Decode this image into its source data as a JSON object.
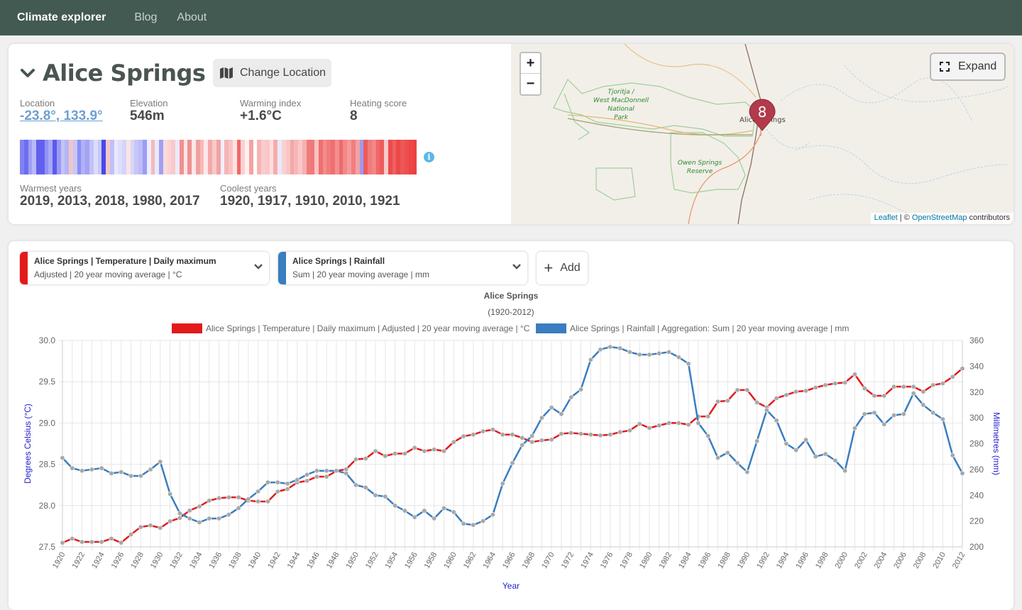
{
  "nav": {
    "brand": "Climate explorer",
    "links": [
      "Blog",
      "About"
    ]
  },
  "location": {
    "title": "Alice Springs",
    "change_label": "Change Location",
    "stats": [
      {
        "label": "Location",
        "value": "-23.8°, 133.9°",
        "link": true
      },
      {
        "label": "Elevation",
        "value": "546m"
      },
      {
        "label": "Warming index",
        "value": "+1.6°C"
      },
      {
        "label": "Heating score",
        "value": "8"
      }
    ],
    "warmest_label": "Warmest years",
    "warmest_value": "2019, 2013, 2018, 1980, 2017",
    "coolest_label": "Coolest years",
    "coolest_value": "1920, 1917, 1910, 2010, 1921",
    "stripe_colors": [
      "#8282f2",
      "#6d6df0",
      "#9f9ff5",
      "#b9b9f7",
      "#6060ee",
      "#6060ee",
      "#9292f4",
      "#a9a9f5",
      "#5a5aee",
      "#9a9af4",
      "#c3c3f8",
      "#b5b5f6",
      "#f0c5c5",
      "#c6c6f8",
      "#8e8ef3",
      "#b0b0f6",
      "#a3a3f4",
      "#c2c2f7",
      "#dcdcfa",
      "#c9c9f8",
      "#4848ec",
      "#f5c7c7",
      "#c0c0f7",
      "#e8e8fc",
      "#dedefb",
      "#d4d4fa",
      "#f9e4e4",
      "#d6d6fa",
      "#c6c6f8",
      "#bdbdf7",
      "#9c9cf4",
      "#ededfd",
      "#f4b9b9",
      "#e9e9fc",
      "#a0a0f5",
      "#fadada",
      "#f9d3d3",
      "#f7caca",
      "#eaeafc",
      "#f48f8f",
      "#fbe5e5",
      "#f09090",
      "#fbe7e7",
      "#f29f9f",
      "#f6b9b9",
      "#fde9e9",
      "#f4a9a9",
      "#f8c9c9",
      "#f1a3a3",
      "#ecf0ff",
      "#f5b5b5",
      "#f8c3c3",
      "#fde3e3",
      "#ef6969",
      "#f9d0d0",
      "#fff0f0",
      "#f5a1a1",
      "#ffffff",
      "#f7b3b3",
      "#f8cccc",
      "#f9c7c7",
      "#fcdede",
      "#f4adad",
      "#e9e9fc",
      "#fad1d1",
      "#f8c5c5",
      "#f4a7a7",
      "#f7b7b7",
      "#f9c8c8",
      "#f6b1b1",
      "#f07c7c",
      "#f07979",
      "#f8c3c3",
      "#f06f6f",
      "#f28c8c",
      "#f07b7b",
      "#ef7070",
      "#f09090",
      "#ee6a6a",
      "#f28888",
      "#f39b9b",
      "#f07e7e",
      "#f4a2a2",
      "#9b9bf4",
      "#ed5a5a",
      "#f07b7b",
      "#f38686",
      "#f06767",
      "#ee5b5b",
      "#f9cbcb",
      "#ec4b4b",
      "#f05f5f",
      "#ec4848",
      "#ee5757",
      "#ed4f4f",
      "#ec4646",
      "#ec4141"
    ],
    "info_icon": "info-icon"
  },
  "map": {
    "zoom_in": "+",
    "zoom_out": "−",
    "expand_label": "Expand",
    "marker_label": "8",
    "place_label": "Alice Springs",
    "park1": [
      "Tjoritja /",
      "West MacDonnell",
      "National",
      "Park"
    ],
    "park2": [
      "Owen Springs",
      "Reserve"
    ],
    "attr_leaflet": "Leaflet",
    "attr_sep": " | © ",
    "attr_osm": "OpenStreetMap",
    "attr_tail": " contributors"
  },
  "series_selectors": [
    {
      "line1": "Alice Springs | Temperature | Daily maximum",
      "line2": "Adjusted | 20 year moving average | °C",
      "color": "#e31a1c"
    },
    {
      "line1": "Alice Springs | Rainfall",
      "line2": "Sum | 20 year moving average | mm",
      "color": "#3a7dc0"
    }
  ],
  "add_label": "Add",
  "chart_data": {
    "type": "line",
    "title": "Alice Springs",
    "subtitle": "(1920-2012)",
    "xlabel": "Year",
    "ylabel_left": "Degrees Celsius (°C)",
    "ylabel_right": "Millimetres (mm)",
    "x": [
      1920,
      1921,
      1922,
      1923,
      1924,
      1925,
      1926,
      1927,
      1928,
      1929,
      1930,
      1931,
      1932,
      1933,
      1934,
      1935,
      1936,
      1937,
      1938,
      1939,
      1940,
      1941,
      1942,
      1943,
      1944,
      1945,
      1946,
      1947,
      1948,
      1949,
      1950,
      1951,
      1952,
      1953,
      1954,
      1955,
      1956,
      1957,
      1958,
      1959,
      1960,
      1961,
      1962,
      1963,
      1964,
      1965,
      1966,
      1967,
      1968,
      1969,
      1970,
      1971,
      1972,
      1973,
      1974,
      1975,
      1976,
      1977,
      1978,
      1979,
      1980,
      1981,
      1982,
      1983,
      1984,
      1985,
      1986,
      1987,
      1988,
      1989,
      1990,
      1991,
      1992,
      1993,
      1994,
      1995,
      1996,
      1997,
      1998,
      1999,
      2000,
      2001,
      2002,
      2003,
      2004,
      2005,
      2006,
      2007,
      2008,
      2009,
      2010,
      2011,
      2012
    ],
    "ylim_left": [
      27.5,
      30.0
    ],
    "ylim_right": [
      200,
      360
    ],
    "series": [
      {
        "name": "Alice Springs | Temperature | Daily maximum | Adjusted | 20 year moving average | °C",
        "axis": "left",
        "color": "#e31a1c",
        "values": [
          27.55,
          27.6,
          27.56,
          27.56,
          27.56,
          27.6,
          27.55,
          27.65,
          27.74,
          27.76,
          27.73,
          27.81,
          27.85,
          27.94,
          27.99,
          28.06,
          28.09,
          28.1,
          28.1,
          28.06,
          28.05,
          28.05,
          28.17,
          28.2,
          28.28,
          28.3,
          28.35,
          28.35,
          28.42,
          28.44,
          28.56,
          28.57,
          28.66,
          28.6,
          28.63,
          28.63,
          28.7,
          28.66,
          28.68,
          28.66,
          28.77,
          28.84,
          28.86,
          28.9,
          28.92,
          28.86,
          28.86,
          28.82,
          28.77,
          28.79,
          28.8,
          28.87,
          28.88,
          28.87,
          28.86,
          28.85,
          28.86,
          28.89,
          28.91,
          28.99,
          28.94,
          28.97,
          29.0,
          29.0,
          28.98,
          29.08,
          29.08,
          29.26,
          29.27,
          29.4,
          29.4,
          29.25,
          29.19,
          29.3,
          29.34,
          29.38,
          29.39,
          29.43,
          29.46,
          29.48,
          29.49,
          29.59,
          29.42,
          29.33,
          29.33,
          29.44,
          29.44,
          29.44,
          29.38,
          29.46,
          29.48,
          29.56,
          29.66
        ]
      },
      {
        "name": "Alice Springs | Rainfall | Aggregation: Sum | 20 year moving average | mm",
        "axis": "right",
        "color": "#3a7dc0",
        "values": [
          269,
          261,
          259,
          260,
          261,
          257,
          258,
          255,
          255,
          260,
          266,
          241,
          226,
          222,
          219,
          222,
          222,
          225,
          230,
          237,
          243,
          250,
          250,
          249,
          252,
          256,
          259,
          259,
          259,
          257,
          248,
          246,
          240,
          239,
          232,
          228,
          223,
          228,
          222,
          230,
          227,
          218,
          217,
          220,
          225,
          249,
          265,
          279,
          286,
          300,
          308,
          303,
          316,
          322,
          345,
          353,
          355,
          354,
          351,
          349,
          349,
          350,
          351,
          347,
          342,
          296,
          286,
          269,
          273,
          265,
          258,
          282,
          306,
          298,
          280,
          275,
          283,
          270,
          272,
          267,
          259,
          292,
          303,
          304,
          295,
          302,
          303,
          319,
          310,
          304,
          299,
          271,
          257
        ]
      }
    ]
  }
}
